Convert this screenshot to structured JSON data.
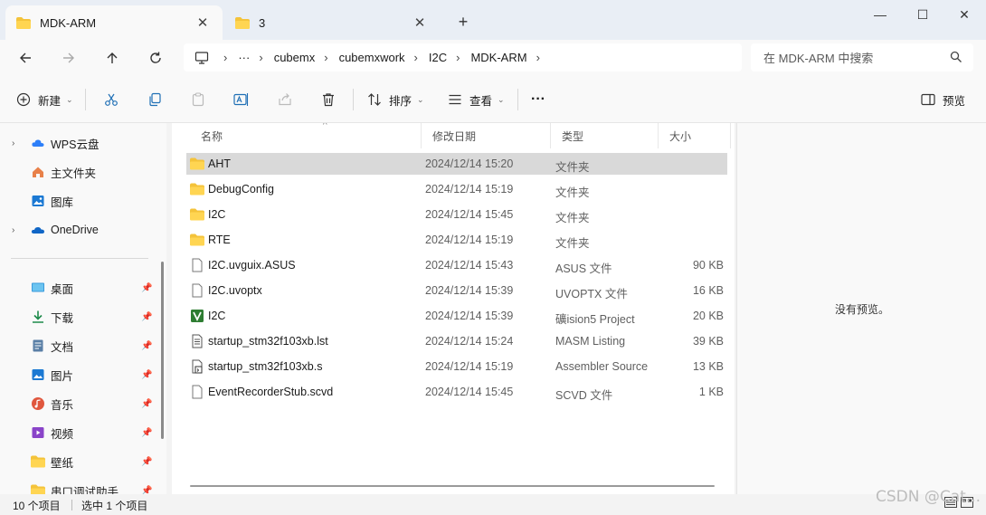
{
  "tabs": [
    {
      "label": "MDK-ARM",
      "active": true
    },
    {
      "label": "3",
      "active": false
    }
  ],
  "window_controls": {
    "minimize": "—",
    "maximize": "☐",
    "close": "✕"
  },
  "breadcrumb": [
    "cubemx",
    "cubemxwork",
    "I2C",
    "MDK-ARM"
  ],
  "search": {
    "placeholder": "在 MDK-ARM 中搜索"
  },
  "toolbar": {
    "new_label": "新建",
    "sort_label": "排序",
    "view_label": "查看",
    "more_label": "···",
    "preview_label": "预览"
  },
  "sidebar": {
    "top_items": [
      {
        "label": "WPS云盘",
        "icon": "cloud-icon",
        "expandable": true
      },
      {
        "label": "主文件夹",
        "icon": "home-icon",
        "expandable": false
      },
      {
        "label": "图库",
        "icon": "gallery-icon",
        "expandable": false
      },
      {
        "label": "OneDrive",
        "icon": "onedrive-icon",
        "expandable": true
      }
    ],
    "pinned_items": [
      {
        "label": "桌面",
        "icon": "desktop-icon"
      },
      {
        "label": "下载",
        "icon": "download-icon"
      },
      {
        "label": "文档",
        "icon": "documents-icon"
      },
      {
        "label": "图片",
        "icon": "pictures-icon"
      },
      {
        "label": "音乐",
        "icon": "music-icon"
      },
      {
        "label": "视频",
        "icon": "videos-icon"
      },
      {
        "label": "壁纸",
        "icon": "folder-icon"
      },
      {
        "label": "串口调试助手",
        "icon": "folder-icon"
      }
    ]
  },
  "columns": {
    "name": "名称",
    "modified": "修改日期",
    "type": "类型",
    "size": "大小"
  },
  "files": [
    {
      "name": "AHT",
      "modified": "2024/12/14 15:20",
      "type": "文件夹",
      "size": "",
      "icon": "folder-icon",
      "selected": true
    },
    {
      "name": "DebugConfig",
      "modified": "2024/12/14 15:19",
      "type": "文件夹",
      "size": "",
      "icon": "folder-icon",
      "selected": false
    },
    {
      "name": "I2C",
      "modified": "2024/12/14 15:45",
      "type": "文件夹",
      "size": "",
      "icon": "folder-icon",
      "selected": false
    },
    {
      "name": "RTE",
      "modified": "2024/12/14 15:19",
      "type": "文件夹",
      "size": "",
      "icon": "folder-icon",
      "selected": false
    },
    {
      "name": "I2C.uvguix.ASUS",
      "modified": "2024/12/14 15:43",
      "type": "ASUS 文件",
      "size": "90 KB",
      "icon": "file-icon",
      "selected": false
    },
    {
      "name": "I2C.uvoptx",
      "modified": "2024/12/14 15:39",
      "type": "UVOPTX 文件",
      "size": "16 KB",
      "icon": "file-icon",
      "selected": false
    },
    {
      "name": "I2C",
      "modified": "2024/12/14 15:39",
      "type": "礦ision5 Project",
      "size": "20 KB",
      "icon": "keil-project-icon",
      "selected": false
    },
    {
      "name": "startup_stm32f103xb.lst",
      "modified": "2024/12/14 15:24",
      "type": "MASM Listing",
      "size": "39 KB",
      "icon": "text-file-icon",
      "selected": false
    },
    {
      "name": "startup_stm32f103xb.s",
      "modified": "2024/12/14 15:19",
      "type": "Assembler Source",
      "size": "13 KB",
      "icon": "source-file-icon",
      "selected": false
    },
    {
      "name": "EventRecorderStub.scvd",
      "modified": "2024/12/14 15:45",
      "type": "SCVD 文件",
      "size": "1 KB",
      "icon": "file-icon",
      "selected": false
    }
  ],
  "preview": {
    "message": "没有预览。"
  },
  "status": {
    "item_count": "10 个项目",
    "selection": "选中 1 个项目"
  },
  "watermark": "CSDN @Cat..."
}
